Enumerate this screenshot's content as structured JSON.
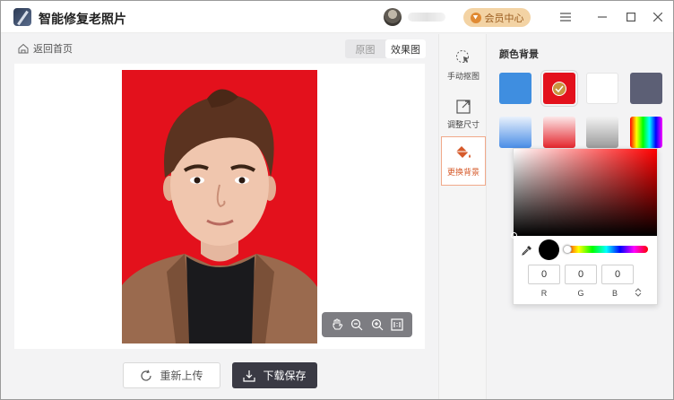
{
  "app": {
    "title": "智能修复老照片"
  },
  "titlebar": {
    "vip_label": "会员中心"
  },
  "toolbar": {
    "back_label": "返回首页",
    "tab_original": "原图",
    "tab_result": "效果图"
  },
  "actions": {
    "reupload_label": "重新上传",
    "download_label": "下载保存"
  },
  "rail": {
    "items": [
      {
        "label": "手动抠图",
        "icon": "cursor-select-icon"
      },
      {
        "label": "调整尺寸",
        "icon": "resize-icon"
      },
      {
        "label": "更换背景",
        "icon": "paint-bucket-icon"
      }
    ],
    "active_index": 2
  },
  "background_panel": {
    "section_title": "颜色背景",
    "swatches": [
      {
        "name": "blue",
        "color": "#3f8ee0"
      },
      {
        "name": "red",
        "color": "#e3111c",
        "selected": true
      },
      {
        "name": "white",
        "color": "#ffffff"
      },
      {
        "name": "dark-gray",
        "color": "#5c5f75"
      },
      {
        "name": "blue-gradient",
        "color": "#4a8de6"
      },
      {
        "name": "red-gradient",
        "color": "#e4262d"
      },
      {
        "name": "gray-gradient",
        "color": "#9a9a9a"
      },
      {
        "name": "rainbow",
        "color": "multi"
      }
    ],
    "selected_color": "#e3111c"
  },
  "color_picker": {
    "current_color": "#000000",
    "r": "0",
    "g": "0",
    "b": "0",
    "label_r": "R",
    "label_g": "G",
    "label_b": "B"
  },
  "photo": {
    "background_color": "#e3111c"
  }
}
